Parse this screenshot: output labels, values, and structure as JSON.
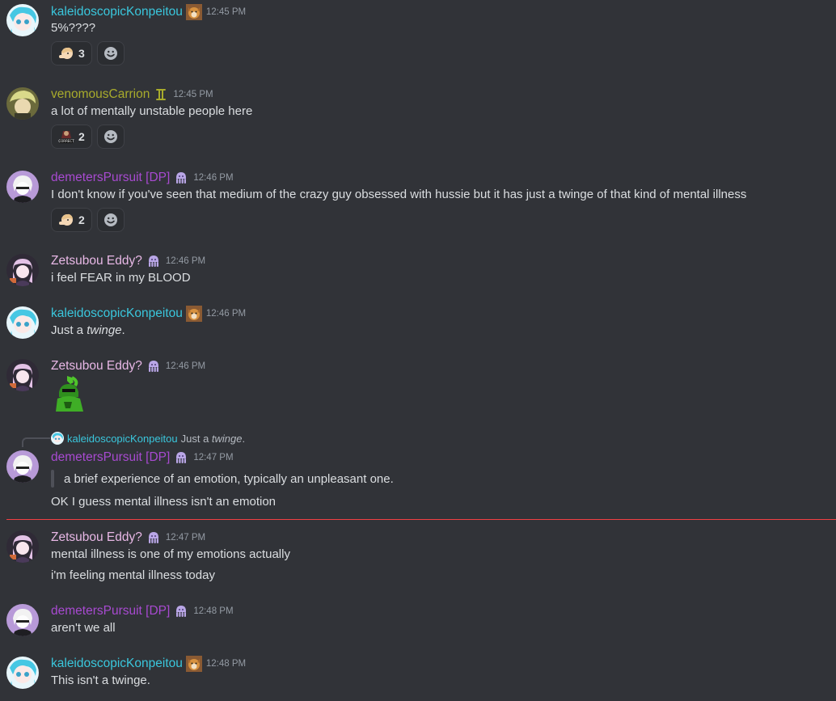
{
  "messages": [
    {
      "user": "kaleidoscopicKonpeitou",
      "badge": "dog-icon",
      "time": "12:45 PM",
      "lines": [
        "5%????"
      ],
      "reactions": [
        {
          "emoji": "pointing-character-emoji",
          "count": "3"
        }
      ]
    },
    {
      "user": "venomousCarrion",
      "badge": "gemini-icon",
      "time": "12:45 PM",
      "lines": [
        "a lot of mentally unstable people here"
      ],
      "reactions": [
        {
          "emoji": "correct-emoji",
          "count": "2"
        }
      ]
    },
    {
      "user": "demetersPursuit [DP]",
      "badge": "octopus-icon",
      "time": "12:46 PM",
      "lines": [
        "I don't know if you've seen that medium of the crazy guy obsessed with hussie but it has just a twinge of that kind of mental illness"
      ],
      "reactions": [
        {
          "emoji": "pointing-character-emoji",
          "count": "2"
        }
      ]
    },
    {
      "user": "Zetsubou Eddy?",
      "badge": "octopus-icon",
      "time": "12:46 PM",
      "lines": [
        "i feel FEAR in my BLOOD"
      ]
    },
    {
      "user": "kaleidoscopicKonpeitou",
      "badge": "dog-icon",
      "time": "12:46 PM",
      "line_prefix": "Just a ",
      "line_em": "twinge",
      "line_suffix": "."
    },
    {
      "user": "Zetsubou Eddy?",
      "badge": "octopus-icon",
      "time": "12:46 PM",
      "sticker": "green-goblin-sticker"
    },
    {
      "reply_to": {
        "user": "kaleidoscopicKonpeitou",
        "prefix": "Just a ",
        "em": "twinge",
        "suffix": "."
      },
      "user": "demetersPursuit [DP]",
      "badge": "octopus-icon",
      "time": "12:47 PM",
      "quote": "a brief experience of an emotion, typically an unpleasant one.",
      "lines": [
        "OK I guess mental illness isn't an emotion"
      ]
    },
    {
      "user": "Zetsubou Eddy?",
      "badge": "octopus-icon",
      "time": "12:47 PM",
      "lines": [
        "mental illness is one of my emotions actually",
        "i'm feeling mental illness today"
      ]
    },
    {
      "user": "demetersPursuit [DP]",
      "badge": "octopus-icon",
      "time": "12:48 PM",
      "lines": [
        "aren't we all"
      ]
    },
    {
      "user": "kaleidoscopicKonpeitou",
      "badge": "dog-icon",
      "time": "12:48 PM",
      "lines": [
        "This isn't a twinge."
      ]
    }
  ],
  "colors": {
    "background": "#313338",
    "kaleidoscopicKonpeitou": "#3ac7dd",
    "venomousCarrion": "#a8ab2c",
    "demetersPursuit": "#a84ad1",
    "zetsubouEddy": "#e8b8e6",
    "new_messages_divider": "#f23f43"
  }
}
